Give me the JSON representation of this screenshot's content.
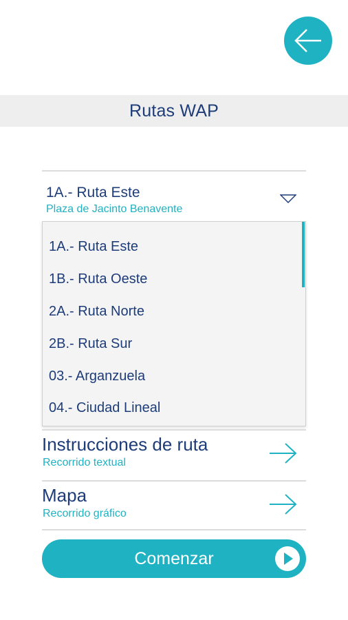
{
  "colors": {
    "accent": "#1fb2c2",
    "text": "#1d3c78",
    "header_bg": "#eeeeee"
  },
  "icons": {
    "back": "arrow-left-icon",
    "caret": "chevron-down-icon",
    "row_arrow": "arrow-right-icon",
    "play": "play-icon"
  },
  "header": {
    "title": "Rutas WAP"
  },
  "selector": {
    "title": "1A.- Ruta Este",
    "subtitle": "Plaza de Jacinto Benavente"
  },
  "dropdown": {
    "items": [
      "1A.- Ruta Este",
      "1B.- Ruta Oeste",
      "2A.- Ruta Norte",
      "2B.- Ruta Sur",
      "03.- Arganzuela",
      "04.- Ciudad Lineal"
    ]
  },
  "options": [
    {
      "title": "Instrucciones de ruta",
      "subtitle": "Recorrido textual"
    },
    {
      "title": "Mapa",
      "subtitle": "Recorrido gráfico"
    }
  ],
  "start_button": {
    "label": "Comenzar"
  }
}
